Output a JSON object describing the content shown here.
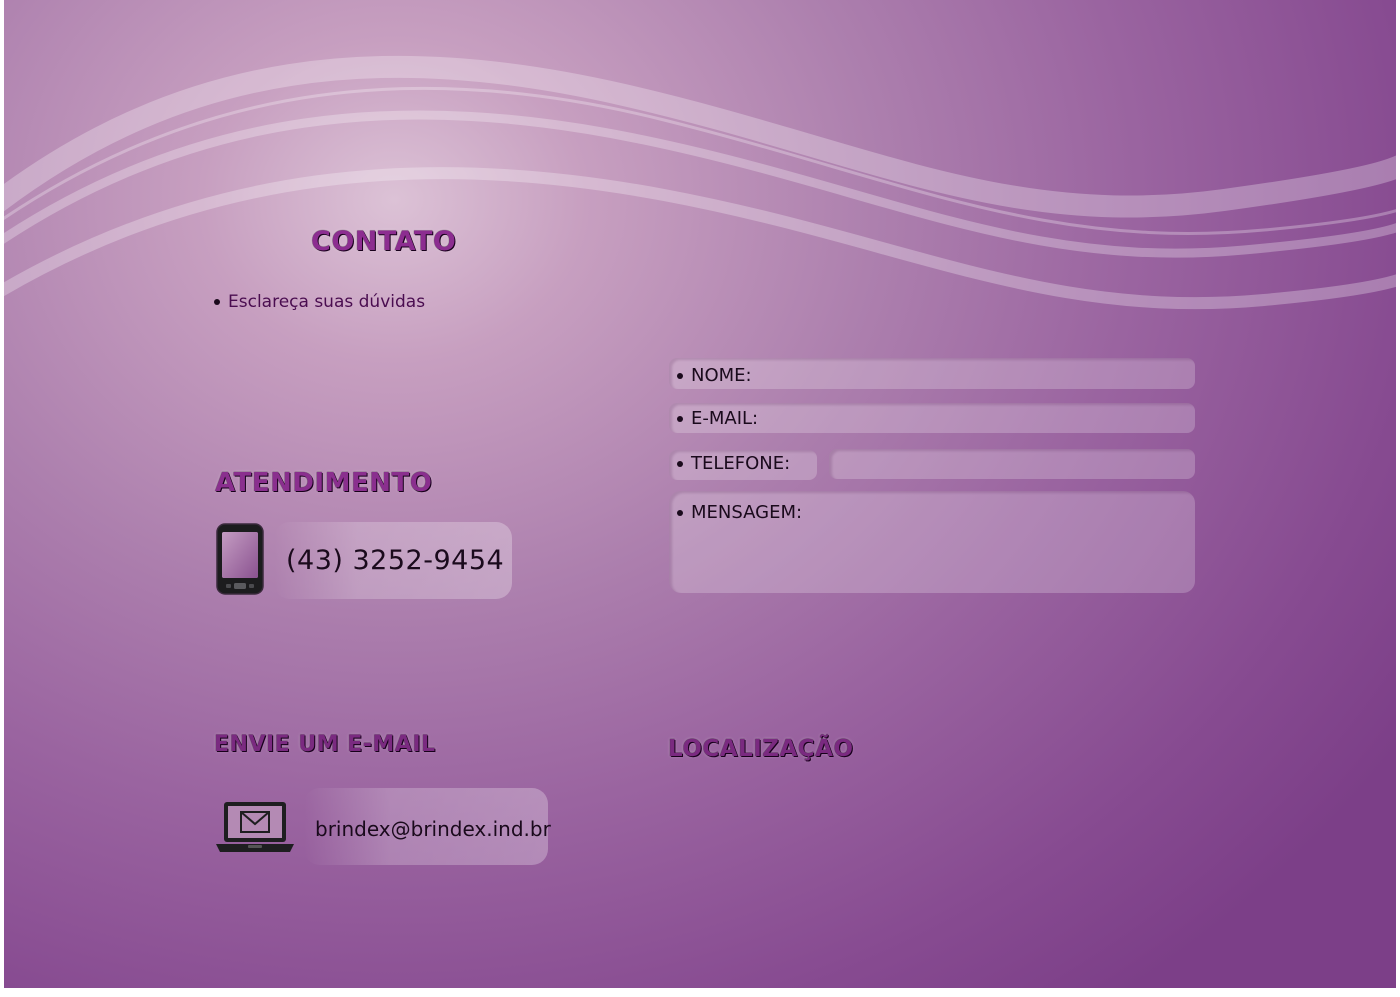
{
  "contato": {
    "title": "CONTATO",
    "subtitle": "Esclareça suas dúvidas"
  },
  "atendimento": {
    "title": "ATENDIMENTO",
    "phone": "(43) 3252-9454",
    "icon": "smartphone-icon"
  },
  "email_section": {
    "title": "ENVIE UM E-MAIL",
    "address": "brindex@brindex.ind.br",
    "icon": "laptop-mail-icon"
  },
  "form": {
    "nome_label": "NOME:",
    "email_label": "E-MAIL:",
    "telefone_label": "TELEFONE:",
    "mensagem_label": "MENSAGEM:"
  },
  "localizacao": {
    "title": "LOCALIZAÇÃO"
  },
  "colors": {
    "background_light": "#dcc2d6",
    "background_dark": "#7c3f88",
    "heading": "#8c2d90",
    "text_dark": "#1a0a1c"
  }
}
